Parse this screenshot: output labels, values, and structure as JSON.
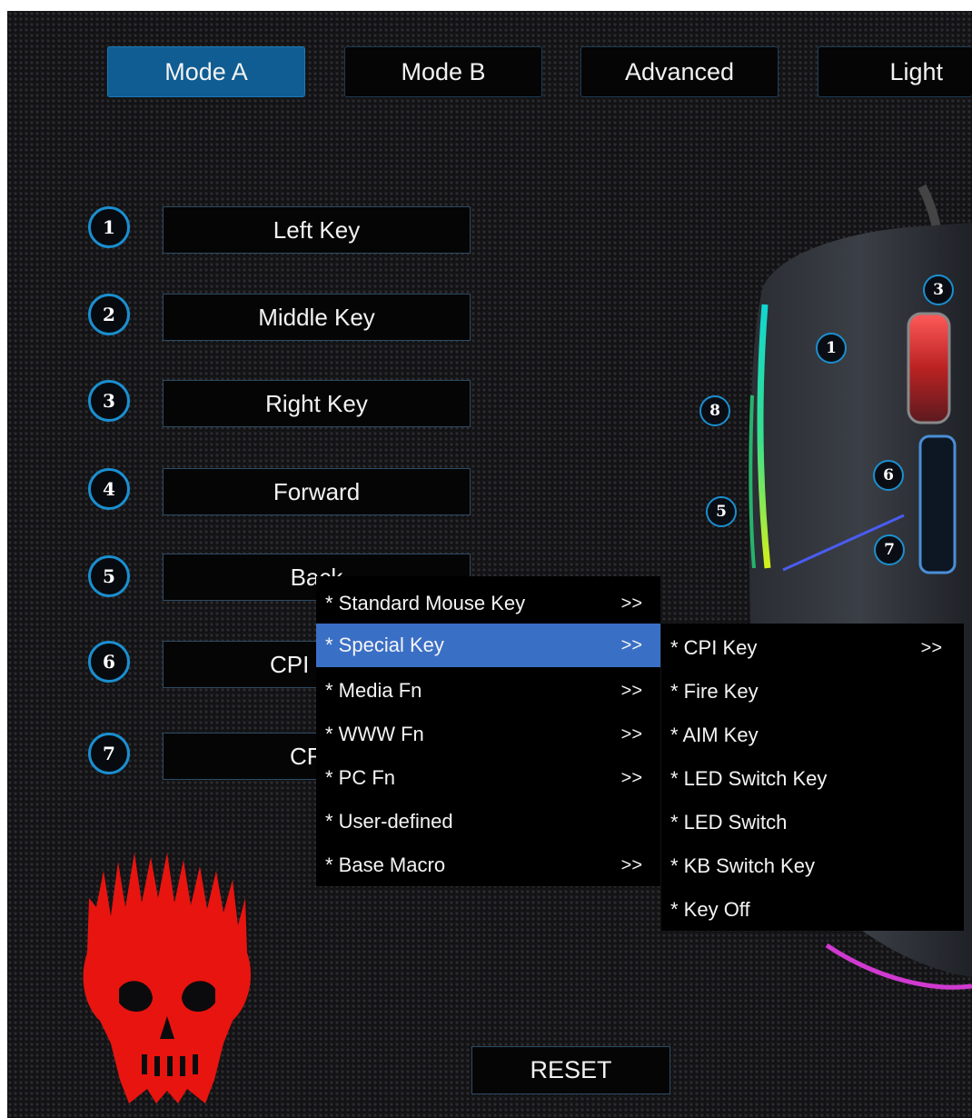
{
  "tabs": [
    {
      "label": "Mode A",
      "active": true
    },
    {
      "label": "Mode B",
      "active": false
    },
    {
      "label": "Advanced",
      "active": false
    },
    {
      "label": "Light",
      "active": false
    }
  ],
  "buttons": [
    {
      "num": "1",
      "label": "Left Key"
    },
    {
      "num": "2",
      "label": "Middle Key"
    },
    {
      "num": "3",
      "label": "Right Key"
    },
    {
      "num": "4",
      "label": "Forward"
    },
    {
      "num": "5",
      "label": "Back"
    },
    {
      "num": "6",
      "label": "CPI L"
    },
    {
      "num": "7",
      "label": "CF"
    }
  ],
  "menu": {
    "items": [
      {
        "label": "* Standard Mouse Key",
        "arrow": ">>"
      },
      {
        "label": "* Special Key",
        "arrow": ">>",
        "highlighted": true
      },
      {
        "label": "* Media Fn",
        "arrow": ">>"
      },
      {
        "label": "* WWW Fn",
        "arrow": ">>"
      },
      {
        "label": "* PC Fn",
        "arrow": ">>"
      },
      {
        "label": "* User-defined",
        "arrow": ""
      },
      {
        "label": "* Base Macro",
        "arrow": ">>"
      }
    ]
  },
  "submenu": {
    "items": [
      {
        "label": "* CPI Key",
        "arrow": ">>"
      },
      {
        "label": "* Fire Key",
        "arrow": ""
      },
      {
        "label": "* AIM Key",
        "arrow": ""
      },
      {
        "label": "* LED Switch Key",
        "arrow": ""
      },
      {
        "label": "* LED Switch",
        "arrow": ""
      },
      {
        "label": "* KB Switch Key",
        "arrow": ""
      },
      {
        "label": "* Key Off",
        "arrow": ""
      }
    ]
  },
  "mouse_labels": [
    "1",
    "3",
    "8",
    "6",
    "5",
    "7"
  ],
  "reset_label": "RESET",
  "colors": {
    "accent": "#1b8fd0",
    "active_tab": "#0f5d92",
    "menu_highlight": "#3a6fc6",
    "skull": "#e8140f"
  }
}
